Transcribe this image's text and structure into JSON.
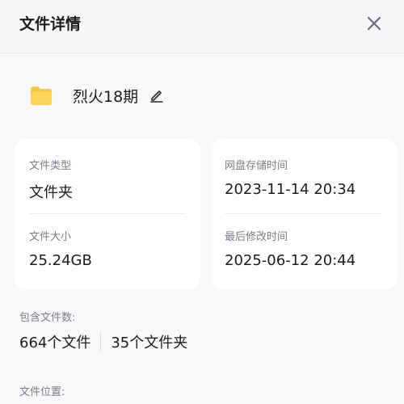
{
  "header": {
    "title": "文件详情",
    "close_icon": "close-icon"
  },
  "file": {
    "name": "烈火18期",
    "icon": "folder-icon",
    "edit_icon": "edit-icon",
    "icon_color": "#f7c948"
  },
  "details": {
    "type_label": "文件类型",
    "type_value": "文件夹",
    "size_label": "文件大小",
    "size_value": "25.24GB",
    "stored_label": "网盘存储时间",
    "stored_value": "2023-11-14 20:34",
    "modified_label": "最后修改时间",
    "modified_value": "2025-06-12 20:44"
  },
  "contents": {
    "label": "包含文件数:",
    "files": "664个文件",
    "folders": "35个文件夹"
  },
  "location": {
    "label": "文件位置:"
  }
}
